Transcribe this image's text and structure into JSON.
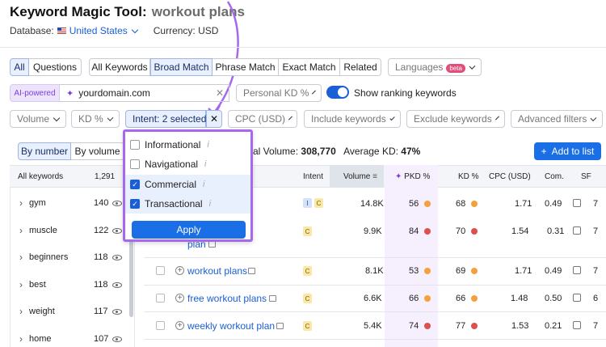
{
  "header": {
    "title": "Keyword Magic Tool:",
    "query": "workout plans"
  },
  "database": {
    "label": "Database:",
    "value": "United States",
    "currency_label": "Currency: USD"
  },
  "tabs": [
    "All",
    "Questions"
  ],
  "match_tabs": [
    "All Keywords",
    "Broad Match",
    "Phrase Match",
    "Exact Match",
    "Related"
  ],
  "languages": {
    "label": "Languages",
    "badge": "beta"
  },
  "ai": {
    "label": "AI-powered",
    "domain": "yourdomain.com",
    "personal_kd": "Personal KD %",
    "show_ranking": "Show ranking keywords"
  },
  "filters": {
    "volume": "Volume",
    "kd": "KD %",
    "intent": "Intent: 2 selected",
    "cpc": "CPC (USD)",
    "include": "Include keywords",
    "exclude": "Exclude keywords",
    "advanced": "Advanced filters"
  },
  "intent_popup": {
    "options": [
      {
        "label": "Informational",
        "checked": false
      },
      {
        "label": "Navigational",
        "checked": false
      },
      {
        "label": "Commercial",
        "checked": true
      },
      {
        "label": "Transactional",
        "checked": true
      }
    ],
    "apply": "Apply"
  },
  "group_toggle": {
    "by_number": "By number",
    "by_volume": "By volume"
  },
  "summary": {
    "volume_label": "al Volume:",
    "volume": "308,770",
    "kd_label": "Average KD:",
    "kd": "47%"
  },
  "add_to_list": "Add to list",
  "sidebar": {
    "header": "All keywords",
    "header_count": "1,291",
    "items": [
      {
        "label": "gym",
        "count": "140"
      },
      {
        "label": "muscle",
        "count": "122"
      },
      {
        "label": "beginners",
        "count": "118"
      },
      {
        "label": "best",
        "count": "118"
      },
      {
        "label": "weight",
        "count": "117"
      },
      {
        "label": "home",
        "count": "107"
      }
    ]
  },
  "table": {
    "columns": [
      "Intent",
      "Volume",
      "PKD %",
      "KD %",
      "CPC (USD)",
      "Com.",
      "SF"
    ],
    "rows": [
      {
        "keyword": "",
        "intent": [
          "I",
          "C"
        ],
        "volume": "14.8K",
        "pkd": "56",
        "pkd_color": "#f5a03a",
        "kd": "68",
        "kd_color": "#f5a03a",
        "cpc": "1.71",
        "com": "0.49",
        "sf": "7"
      },
      {
        "keyword": "ut",
        "keyword2": "plan",
        "intent": [
          "C"
        ],
        "volume": "9.9K",
        "pkd": "84",
        "pkd_color": "#e04e4e",
        "kd": "70",
        "kd_color": "#e04e4e",
        "cpc": "1.54",
        "com": "0.31",
        "sf": "7"
      },
      {
        "keyword": "workout plans",
        "intent": [
          "C"
        ],
        "volume": "8.1K",
        "pkd": "53",
        "pkd_color": "#f5a03a",
        "kd": "69",
        "kd_color": "#f5a03a",
        "cpc": "1.71",
        "com": "0.49",
        "sf": "7"
      },
      {
        "keyword": "free workout plans",
        "intent": [
          "C"
        ],
        "volume": "6.6K",
        "pkd": "66",
        "pkd_color": "#f5a03a",
        "kd": "66",
        "kd_color": "#f5a03a",
        "cpc": "1.48",
        "com": "0.50",
        "sf": "6"
      },
      {
        "keyword": "weekly workout plan",
        "intent": [
          "C"
        ],
        "volume": "5.4K",
        "pkd": "74",
        "pkd_color": "#e04e4e",
        "kd": "77",
        "kd_color": "#e04e4e",
        "cpc": "1.53",
        "com": "0.21",
        "sf": "7"
      }
    ]
  },
  "colors": {
    "accent": "#1a5fd6",
    "highlight": "#a768ee"
  }
}
